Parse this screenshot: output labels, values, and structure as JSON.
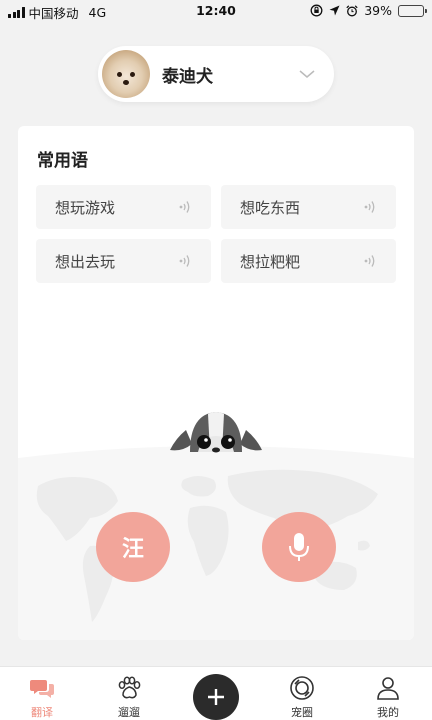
{
  "status_bar": {
    "carrier": "中国移动",
    "network": "4G",
    "time": "12:40",
    "battery": "39%",
    "battery_level": 0.39
  },
  "pet_selector": {
    "name": "泰迪犬"
  },
  "phrases": {
    "title": "常用语",
    "items": [
      "想玩游戏",
      "想吃东西",
      "想出去玩",
      "想拉粑粑"
    ]
  },
  "actions": {
    "bark_label": "汪"
  },
  "tabbar": {
    "items": [
      {
        "label": "翻译",
        "icon": "chat-bubbles-icon",
        "active": true
      },
      {
        "label": "遛遛",
        "icon": "paw-icon",
        "active": false
      },
      {
        "label": "宠圈",
        "icon": "camera-ring-icon",
        "active": false
      },
      {
        "label": "我的",
        "icon": "person-icon",
        "active": false
      }
    ]
  },
  "colors": {
    "accent": "#f2a59a",
    "active_tab": "#ee8a7c",
    "background": "#f2f2f2"
  }
}
